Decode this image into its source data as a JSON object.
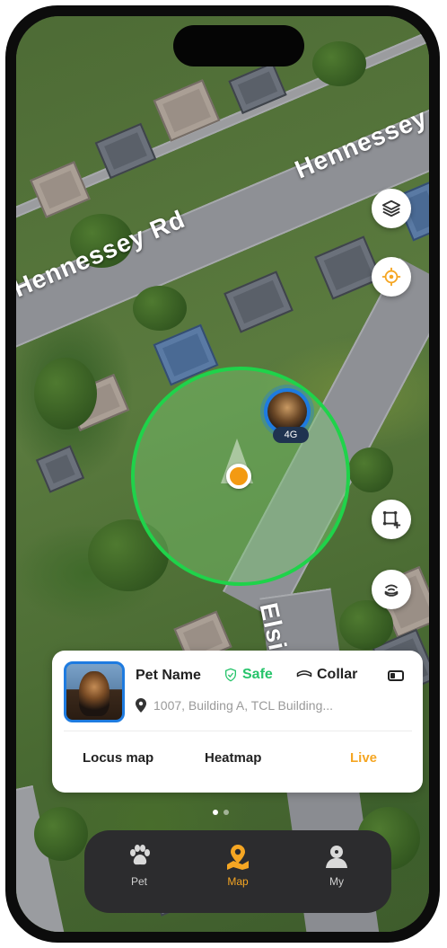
{
  "map": {
    "road_labels": [
      "Hennessey Rd",
      "Hennessey Rd",
      "Elsie"
    ],
    "geofence_color": "#1fd34a",
    "location_dot_color": "#f39a12"
  },
  "pet_marker": {
    "network_badge": "4G",
    "ring_color": "#1e7be0"
  },
  "map_controls": [
    {
      "icon": "layers-icon"
    },
    {
      "icon": "locate-icon"
    },
    {
      "icon": "add-geofence-icon"
    },
    {
      "icon": "collar-signal-icon"
    }
  ],
  "pet_card": {
    "name": "Pet Name",
    "status": "Safe",
    "status_color": "#27c46b",
    "device": "Collar",
    "battery_icon": "battery-low-icon",
    "address": "1007, Building A, TCL Building...",
    "tabs": [
      {
        "label": "Locus map",
        "active": false
      },
      {
        "label": "Heatmap",
        "active": false
      },
      {
        "label": "Live",
        "active": true
      }
    ],
    "accent_color": "#f5a623"
  },
  "pager": {
    "pages": 2,
    "current": 1
  },
  "bottom_nav": {
    "items": [
      {
        "label": "Pet",
        "icon": "paw-icon",
        "active": false
      },
      {
        "label": "Map",
        "icon": "map-pin-icon",
        "active": true
      },
      {
        "label": "My",
        "icon": "user-icon",
        "active": false
      }
    ]
  }
}
